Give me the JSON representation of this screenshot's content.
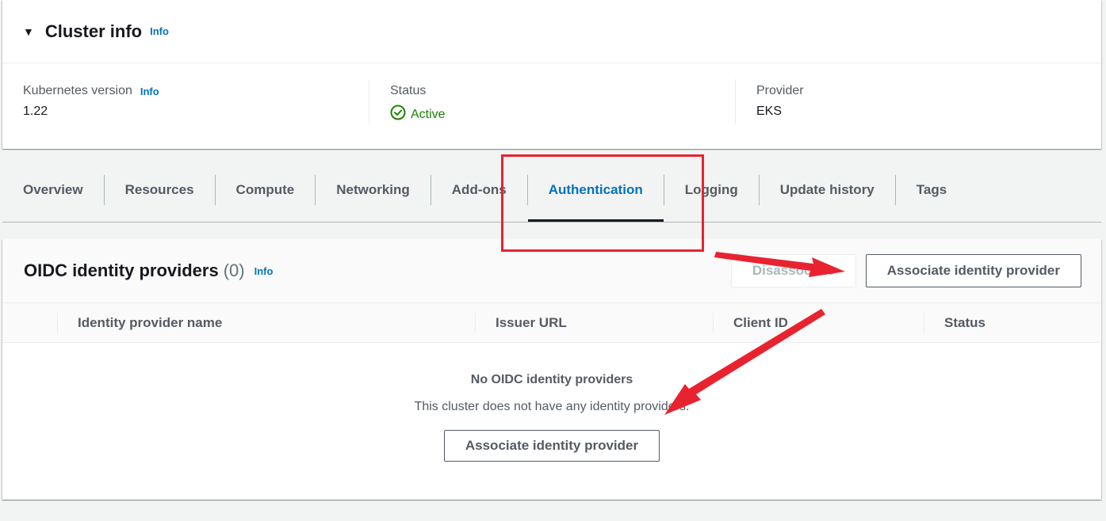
{
  "cluster_info": {
    "title": "Cluster info",
    "info_label": "Info",
    "kubernetes_version": {
      "label": "Kubernetes version",
      "info_label": "Info",
      "value": "1.22"
    },
    "status": {
      "label": "Status",
      "value": "Active"
    },
    "provider": {
      "label": "Provider",
      "value": "EKS"
    }
  },
  "tabs": [
    {
      "label": "Overview"
    },
    {
      "label": "Resources"
    },
    {
      "label": "Compute"
    },
    {
      "label": "Networking"
    },
    {
      "label": "Add-ons"
    },
    {
      "label": "Authentication",
      "active": true
    },
    {
      "label": "Logging"
    },
    {
      "label": "Update history"
    },
    {
      "label": "Tags"
    }
  ],
  "oidc": {
    "title": "OIDC identity providers",
    "count": "(0)",
    "info_label": "Info",
    "disassociate_label": "Disassociate",
    "associate_label": "Associate identity provider",
    "columns": [
      "Identity provider name",
      "Issuer URL",
      "Client ID",
      "Status"
    ],
    "empty_title": "No OIDC identity providers",
    "empty_desc": "This cluster does not have any identity providers.",
    "empty_associate_label": "Associate identity provider"
  },
  "colors": {
    "accent": "#0073bb",
    "active_status": "#1d8102",
    "annotation": "#e8232f"
  },
  "icons": {
    "collapse": "caret-down-icon",
    "status": "check-circle-icon"
  }
}
